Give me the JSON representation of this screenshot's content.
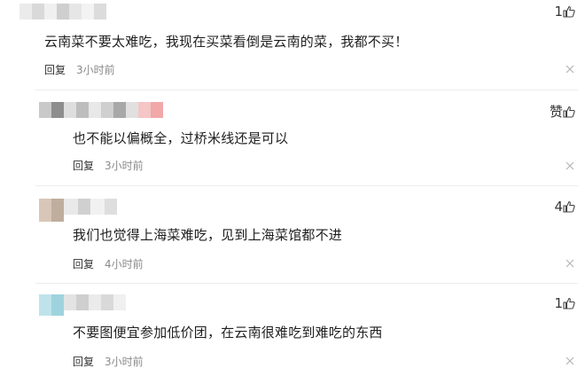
{
  "comments": [
    {
      "text": "云南菜不要太难吃，我现在买菜看倒是云南的菜，我都不买！",
      "like_label": "1",
      "reply_label": "回复",
      "time": "3小时前",
      "name_blocks": [
        "#ebebeb",
        "#d9d9d9",
        "#f0f0f0",
        "#cfcfcf",
        "#e6e6e6",
        "#f3f3f3",
        "#dcdcdc"
      ]
    },
    {
      "text": "也不能以偏概全，过桥米线还是可以",
      "like_label": "赞",
      "reply_label": "回复",
      "time": "3小时前",
      "name_blocks": [
        "#c9c9c9",
        "#8e8e8e",
        "#dedede",
        "#bdbdbd",
        "#e8e8e8",
        "#cfcfcf",
        "#a8a8a8",
        "#e0e0e0",
        "#f5c6c6"
      ]
    },
    {
      "text": "我们也觉得上海菜难吃，见到上海菜馆都不进",
      "like_label": "4",
      "reply_label": "回复",
      "time": "4小时前",
      "name_blocks": [
        "#d8c7b8",
        "#bfae9d",
        "#e9e9e9",
        "#d0d0d0",
        "#f1f1f1",
        "#dedede"
      ]
    },
    {
      "text": "不要图便宜参加低价团，在云南很难吃到难吃的东西",
      "like_label": "1",
      "reply_label": "回复",
      "time": "3小时前",
      "name_blocks": [
        "#bfe3ea",
        "#9ed3de",
        "#e3e3e3",
        "#cfcfcf",
        "#ebebeb",
        "#d9d9d9",
        "#f0f0f0"
      ]
    }
  ]
}
